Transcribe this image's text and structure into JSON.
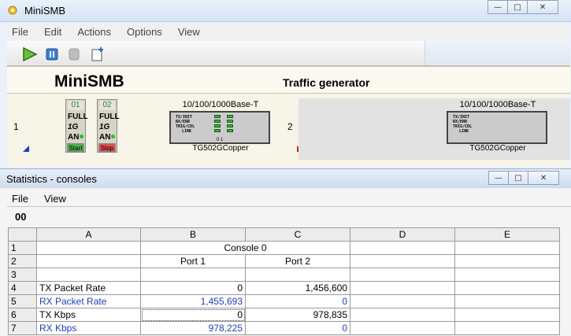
{
  "window": {
    "title": "MiniSMB",
    "icon": "app-logo-icon"
  },
  "menu": {
    "items": [
      "File",
      "Edit",
      "Actions",
      "Options",
      "View"
    ]
  },
  "toolbar": {
    "buttons": [
      "play-icon",
      "pause-icon",
      "disabled-icon",
      "new-document-icon"
    ]
  },
  "header": {
    "brand": "MiniSMB",
    "subtitle": "Traffic generator"
  },
  "chassis": [
    {
      "number": "1",
      "ports": [
        {
          "id": "01",
          "l1": "FULL",
          "l2": "1G",
          "l3": "AN",
          "button": "Start",
          "button_color": "#4caf50"
        },
        {
          "id": "02",
          "l1": "FULL",
          "l2": "1G",
          "l3": "AN",
          "button": "Stop",
          "button_color": "#e05050"
        }
      ],
      "module": {
        "title": "10/100/1000Base-T",
        "labels": [
          "TX/INIT",
          "RX/ERR",
          "TRIG/COL",
          "LINK"
        ],
        "bottom": "0  1",
        "name": "TG502GCopper"
      }
    },
    {
      "number": "2",
      "module": {
        "title": "10/100/1000Base-T",
        "labels": [
          "TX/INIT",
          "RX/ERR",
          "TRIG/COL",
          "LINK"
        ],
        "name": "TG502GCopper"
      }
    }
  ],
  "stats_window": {
    "title": "Statistics - consoles",
    "menu": [
      "File",
      "View"
    ],
    "cell_ref": "00"
  },
  "grid": {
    "columns": [
      "A",
      "B",
      "C",
      "D",
      "E"
    ],
    "rows": [
      {
        "n": "1",
        "a": "",
        "merged": "Console 0"
      },
      {
        "n": "2",
        "a": "",
        "b": "Port 1",
        "c": "Port 2"
      },
      {
        "n": "3",
        "a": "",
        "b": "",
        "c": ""
      },
      {
        "n": "4",
        "a": "TX Packet Rate",
        "b": "0",
        "c": "1,456,600",
        "rx": false
      },
      {
        "n": "5",
        "a": "RX Packet Rate",
        "b": "1,455,693",
        "c": "0",
        "rx": true
      },
      {
        "n": "6",
        "a": "TX Kbps",
        "b": "0",
        "c": "978,835",
        "rx": false
      },
      {
        "n": "7",
        "a": "RX Kbps",
        "b": "978,225",
        "c": "0",
        "rx": true
      }
    ]
  }
}
